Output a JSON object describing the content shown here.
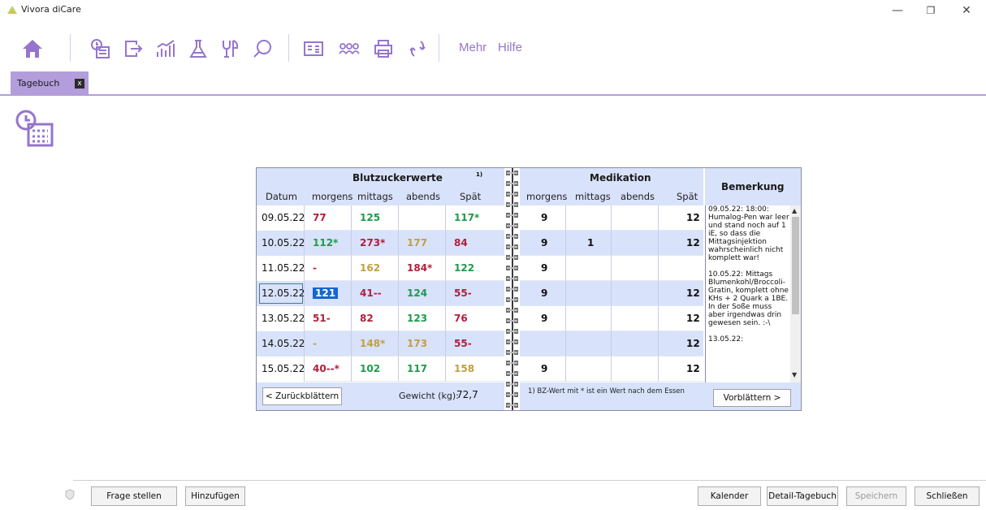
{
  "window": {
    "title": "Vivora diCare",
    "minimize": "—",
    "restore": "❐",
    "close": "✕"
  },
  "toolbar": {
    "mehr": "Mehr",
    "hilfe": "Hilfe"
  },
  "tab": {
    "label": "Tagebuch",
    "close": "x"
  },
  "bz": {
    "title": "Blutzuckerwerte",
    "footnote_marker": "1)",
    "columns": [
      "Datum",
      "morgens",
      "mittags",
      "abends",
      "Spät"
    ]
  },
  "med": {
    "title": "Medikation",
    "columns": [
      "morgens",
      "mittags",
      "abends",
      "Spät"
    ]
  },
  "remark": {
    "title": "Bemerkung",
    "entries": [
      "09.05.22: 18:00: Humalog-Pen war leer und stand noch auf 1 iE, so dass die Mittagsinjektion wahrscheinlich nicht komplett war!",
      "10.05.22: Mittags Blumenkohl/Broccoli-Gratin, komplett ohne KHs + 2 Quark a 1BE. In der Soße muss aber irgendwas drin gewesen sein. :-\\",
      "13.05.22:"
    ]
  },
  "rows": [
    {
      "date": "09.05.22",
      "bz": [
        {
          "v": "77",
          "c": "#b0203c"
        },
        {
          "v": "125",
          "c": "#1f9a4a"
        },
        {
          "v": "",
          "c": ""
        },
        {
          "v": "117*",
          "c": "#1f9a4a"
        }
      ],
      "med": [
        "9",
        "",
        "",
        "12"
      ]
    },
    {
      "date": "10.05.22",
      "bz": [
        {
          "v": "112*",
          "c": "#1f9a4a"
        },
        {
          "v": "273*",
          "c": "#b0203c"
        },
        {
          "v": "177",
          "c": "#c0a040"
        },
        {
          "v": "84",
          "c": "#b0203c"
        }
      ],
      "med": [
        "9",
        "1",
        "",
        "12"
      ]
    },
    {
      "date": "11.05.22",
      "bz": [
        {
          "v": "-",
          "c": "#b0203c"
        },
        {
          "v": "162",
          "c": "#c0a040"
        },
        {
          "v": "184*",
          "c": "#b0203c"
        },
        {
          "v": "122",
          "c": "#1f9a4a"
        }
      ],
      "med": [
        "9",
        "",
        "",
        ""
      ]
    },
    {
      "date": "12.05.22",
      "bz": [
        {
          "v": "121",
          "c": "#1f9a4a"
        },
        {
          "v": "41--",
          "c": "#b0203c"
        },
        {
          "v": "124",
          "c": "#1f9a4a"
        },
        {
          "v": "55-",
          "c": "#b0203c"
        }
      ],
      "med": [
        "9",
        "",
        "",
        "12"
      ]
    },
    {
      "date": "13.05.22",
      "bz": [
        {
          "v": "51-",
          "c": "#b0203c"
        },
        {
          "v": "82",
          "c": "#b0203c"
        },
        {
          "v": "123",
          "c": "#1f9a4a"
        },
        {
          "v": "76",
          "c": "#b0203c"
        }
      ],
      "med": [
        "9",
        "",
        "",
        "12"
      ]
    },
    {
      "date": "14.05.22",
      "bz": [
        {
          "v": "-",
          "c": "#c0a040"
        },
        {
          "v": "148*",
          "c": "#c0a040"
        },
        {
          "v": "173",
          "c": "#c0a040"
        },
        {
          "v": "55-",
          "c": "#b0203c"
        }
      ],
      "med": [
        "",
        "",
        "",
        "12"
      ]
    },
    {
      "date": "15.05.22",
      "bz": [
        {
          "v": "40--*",
          "c": "#b0203c"
        },
        {
          "v": "102",
          "c": "#1f9a4a"
        },
        {
          "v": "117",
          "c": "#1f9a4a"
        },
        {
          "v": "158",
          "c": "#c0a040"
        }
      ],
      "med": [
        "9",
        "",
        "",
        "12"
      ]
    }
  ],
  "selected_row": 3,
  "footer": {
    "back": "< Zurückblättern",
    "weight_label": "Gewicht (kg):",
    "weight_value": "72,7",
    "footnote": "1) BZ-Wert mit * ist ein Wert nach dem Essen",
    "forward": "Vorblättern >"
  },
  "bottom": {
    "frage": "Frage stellen",
    "hinzufuegen": "Hinzufügen",
    "kalender": "Kalender",
    "detail": "Detail-Tagebuch",
    "speichern": "Speichern",
    "schliessen": "Schließen"
  },
  "colors": {
    "accent": "#9575cd",
    "tab": "#b39ddb",
    "panel": "#d8e2fb",
    "green": "#1f9a4a",
    "red": "#b0203c",
    "yellow": "#c0a040"
  }
}
